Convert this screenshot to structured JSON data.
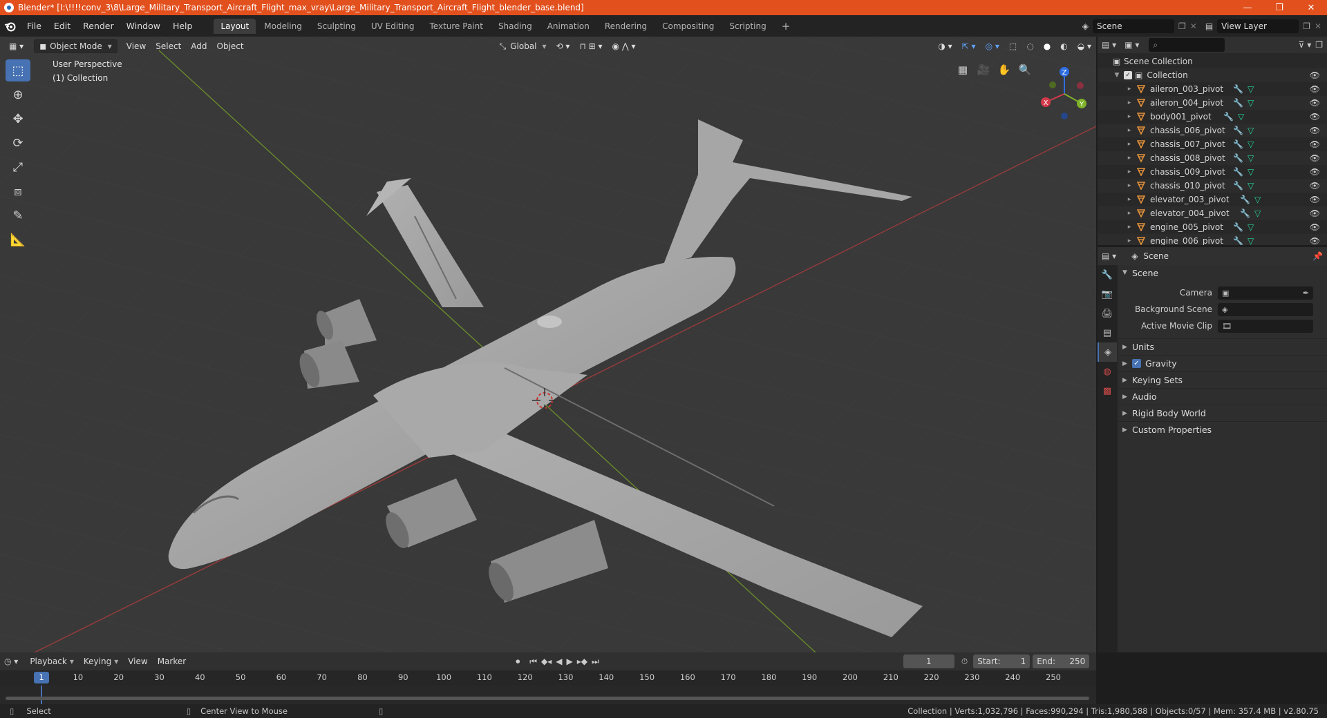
{
  "window": {
    "title": "Blender* [I:\\!!!!conv_3\\8\\Large_Military_Transport_Aircraft_Flight_max_vray\\Large_Military_Transport_Aircraft_Flight_blender_base.blend]",
    "controls": {
      "minimize": "—",
      "maximize": "❐",
      "close": "✕"
    }
  },
  "menubar": {
    "items": [
      "File",
      "Edit",
      "Render",
      "Window",
      "Help"
    ]
  },
  "workspaces": [
    "Layout",
    "Modeling",
    "Sculpting",
    "UV Editing",
    "Texture Paint",
    "Shading",
    "Animation",
    "Rendering",
    "Compositing",
    "Scripting"
  ],
  "workspace_add": "+",
  "scene_field": "Scene",
  "view_layer_field": "View Layer",
  "viewport": {
    "mode": "Object Mode",
    "menus": [
      "View",
      "Select",
      "Add",
      "Object"
    ],
    "transform_orientation": "Global",
    "info_line1": "User Perspective",
    "info_line2": "(1) Collection",
    "axes": {
      "x": "X",
      "y": "Y",
      "z": "Z"
    }
  },
  "outliner": {
    "root": "Scene Collection",
    "collection": "Collection",
    "items": [
      "aileron_003_pivot",
      "aileron_004_pivot",
      "body001_pivot",
      "chassis_006_pivot",
      "chassis_007_pivot",
      "chassis_008_pivot",
      "chassis_009_pivot",
      "chassis_010_pivot",
      "elevator_003_pivot",
      "elevator_004_pivot",
      "engine_005_pivot",
      "engine_006_pivot"
    ]
  },
  "properties": {
    "context": "Scene",
    "panel_title": "Scene",
    "rows": [
      {
        "label": "Camera",
        "value": ""
      },
      {
        "label": "Background Scene",
        "value": ""
      },
      {
        "label": "Active Movie Clip",
        "value": ""
      }
    ],
    "subpanels": [
      "Units",
      "Gravity",
      "Keying Sets",
      "Audio",
      "Rigid Body World",
      "Custom Properties"
    ]
  },
  "timeline": {
    "menus": [
      "Playback",
      "Keying",
      "View",
      "Marker"
    ],
    "current_frame": "1",
    "start_label": "Start:",
    "start": "1",
    "end_label": "End:",
    "end": "250",
    "ticks": [
      "1",
      "10",
      "20",
      "30",
      "40",
      "50",
      "60",
      "70",
      "80",
      "90",
      "100",
      "110",
      "120",
      "130",
      "140",
      "150",
      "160",
      "170",
      "180",
      "190",
      "200",
      "210",
      "220",
      "230",
      "240",
      "250"
    ]
  },
  "statusbar": {
    "left1": "Select",
    "left2": "Center View to Mouse",
    "stats": "Collection | Verts:1,032,796 | Faces:990,294 | Tris:1,980,588 | Objects:0/57 | Mem: 357.4 MB | v2.80.75"
  },
  "colors": {
    "accent": "#4772b3",
    "titlebar": "#e2501d",
    "object_icon": "#e4913a",
    "modifier_icon": "#5fa3ff",
    "mesh_icon": "#26d9a0"
  }
}
